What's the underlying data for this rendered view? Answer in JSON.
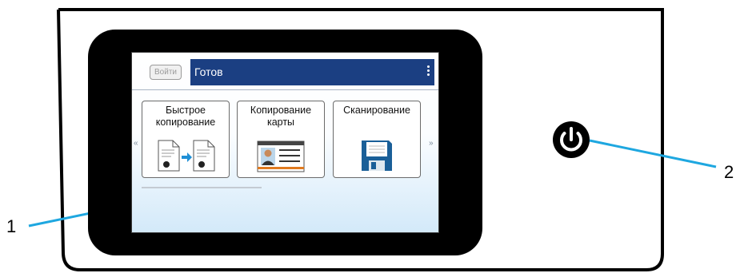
{
  "screen": {
    "login_button": "Войти",
    "status": "Готов",
    "tiles": [
      {
        "label": "Быстрое копирование",
        "icon": "quick-copy-icon"
      },
      {
        "label": "Копирование карты",
        "icon": "id-card-icon"
      },
      {
        "label": "Сканирование",
        "icon": "floppy-disk-icon"
      }
    ],
    "scroll_left": "«",
    "scroll_right": "»"
  },
  "callouts": {
    "screen_number": "1",
    "power_number": "2"
  },
  "power_icon": "power-icon",
  "colors": {
    "status_bar": "#1b3f82",
    "callout_line": "#1ea7e0",
    "bezel": "#000000"
  }
}
